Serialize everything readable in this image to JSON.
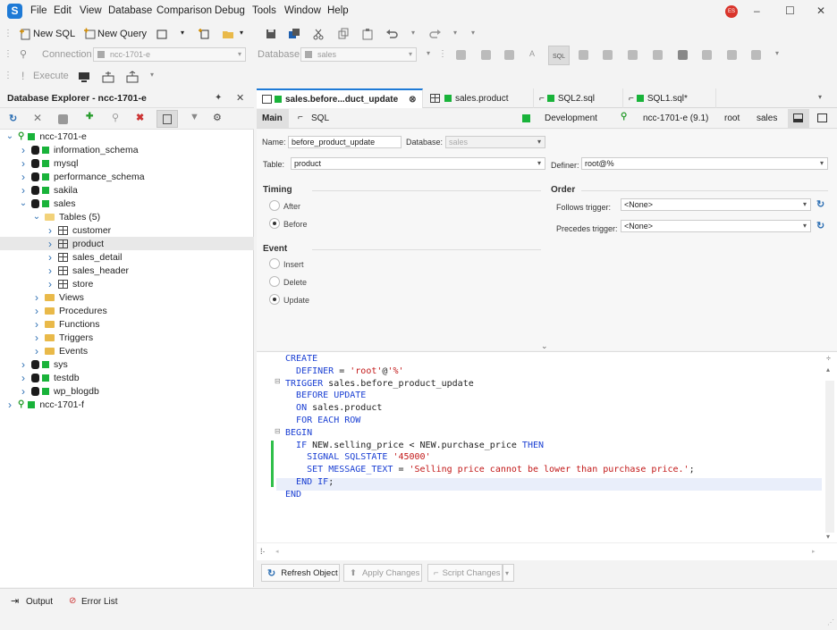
{
  "app": {
    "logo": "S",
    "avatar": "ES"
  },
  "menu": [
    "File",
    "Edit",
    "View",
    "Database",
    "Comparison",
    "Debug",
    "Tools",
    "Window",
    "Help"
  ],
  "window_controls": {
    "minimize": "–",
    "maximize": "☐",
    "close": "✕"
  },
  "toolbar1": {
    "new_sql": "New SQL",
    "new_query": "New Query",
    "connection_label": "Connection",
    "connection_value": "ncc-1701-e",
    "database_label": "Database",
    "database_value": "sales"
  },
  "toolbar2": {
    "execute": "Execute"
  },
  "explorer": {
    "title": "Database Explorer - ncc-1701-e",
    "pin": "✦",
    "close": "✕",
    "tree": [
      {
        "label": "ncc-1701-e",
        "level": 0,
        "kind": "server",
        "chev": "v"
      },
      {
        "label": "information_schema",
        "level": 1,
        "kind": "db",
        "chev": ">"
      },
      {
        "label": "mysql",
        "level": 1,
        "kind": "db",
        "chev": ">"
      },
      {
        "label": "performance_schema",
        "level": 1,
        "kind": "db",
        "chev": ">"
      },
      {
        "label": "sakila",
        "level": 1,
        "kind": "db",
        "chev": ">"
      },
      {
        "label": "sales",
        "level": 1,
        "kind": "db",
        "chev": "v"
      },
      {
        "label": "Tables (5)",
        "level": 2,
        "kind": "folder-open",
        "chev": "v"
      },
      {
        "label": "customer",
        "level": 3,
        "kind": "table",
        "chev": ">"
      },
      {
        "label": "product",
        "level": 3,
        "kind": "table",
        "chev": ">",
        "selected": true
      },
      {
        "label": "sales_detail",
        "level": 3,
        "kind": "table",
        "chev": ">"
      },
      {
        "label": "sales_header",
        "level": 3,
        "kind": "table",
        "chev": ">"
      },
      {
        "label": "store",
        "level": 3,
        "kind": "table",
        "chev": ">"
      },
      {
        "label": "Views",
        "level": 2,
        "kind": "folder",
        "chev": ">"
      },
      {
        "label": "Procedures",
        "level": 2,
        "kind": "folder",
        "chev": ">"
      },
      {
        "label": "Functions",
        "level": 2,
        "kind": "folder",
        "chev": ">"
      },
      {
        "label": "Triggers",
        "level": 2,
        "kind": "folder",
        "chev": ">"
      },
      {
        "label": "Events",
        "level": 2,
        "kind": "folder",
        "chev": ">"
      },
      {
        "label": "sys",
        "level": 1,
        "kind": "db",
        "chev": ">"
      },
      {
        "label": "testdb",
        "level": 1,
        "kind": "db",
        "chev": ">"
      },
      {
        "label": "wp_blogdb",
        "level": 1,
        "kind": "db",
        "chev": ">"
      },
      {
        "label": "ncc-1701-f",
        "level": 0,
        "kind": "server",
        "chev": ">"
      }
    ]
  },
  "tabs": [
    {
      "label": "sales.before...duct_update",
      "active": true,
      "close": "⊗"
    },
    {
      "label": "sales.product",
      "active": false
    },
    {
      "label": "SQL2.sql",
      "active": false
    },
    {
      "label": "SQL1.sql*",
      "active": false
    }
  ],
  "subbar": {
    "main": "Main",
    "sql": "SQL",
    "env": "Development",
    "conn": "ncc-1701-e (9.1)",
    "user": "root",
    "db": "sales"
  },
  "form": {
    "name_label": "Name:",
    "name_value": "before_product_update",
    "database_label": "Database:",
    "database_value": "sales",
    "table_label": "Table:",
    "table_value": "product",
    "definer_label": "Definer:",
    "definer_value": "root@%",
    "timing_title": "Timing",
    "timing": [
      "After",
      "Before"
    ],
    "order_title": "Order",
    "follows_label": "Follows trigger:",
    "follows_value": "<None>",
    "precedes_label": "Precedes trigger:",
    "precedes_value": "<None>",
    "event_title": "Event",
    "event": [
      "Insert",
      "Delete",
      "Update"
    ]
  },
  "code": [
    "CREATE",
    "  DEFINER = 'root'@'%'",
    "TRIGGER sales.before_product_update",
    "  BEFORE UPDATE",
    "  ON sales.product",
    "  FOR EACH ROW",
    "BEGIN",
    "  IF NEW.selling_price < NEW.purchase_price THEN",
    "    SIGNAL SQLSTATE '45000'",
    "    SET MESSAGE_TEXT = 'Selling price cannot be lower than purchase price.';",
    "  END IF;",
    "END"
  ],
  "buttons": {
    "refresh": "Refresh Object",
    "apply": "Apply Changes",
    "script": "Script Changes"
  },
  "status": {
    "output": "Output",
    "errors": "Error List"
  }
}
